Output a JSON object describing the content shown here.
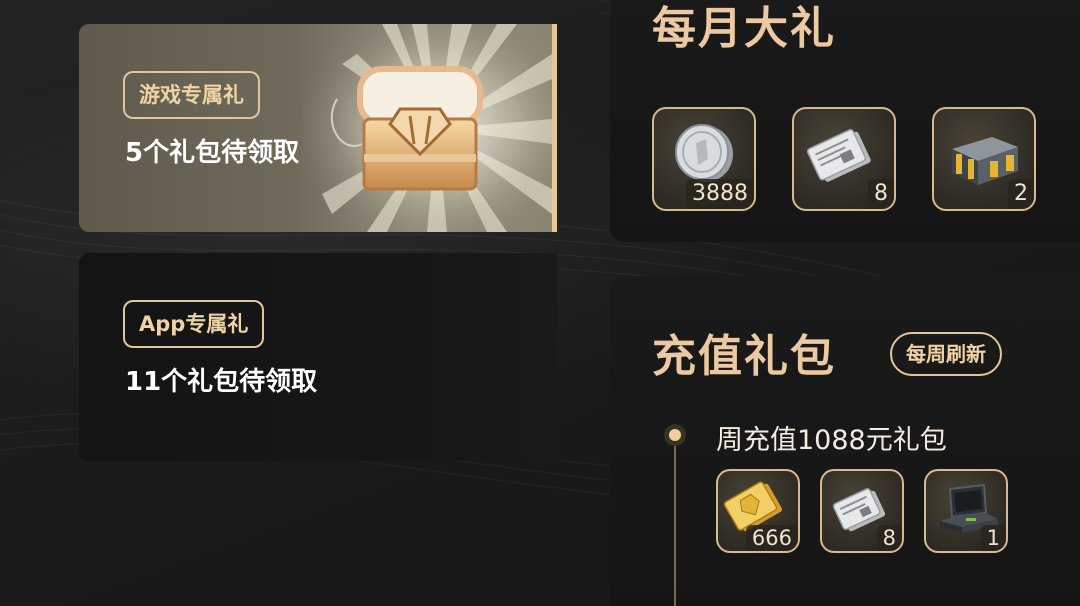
{
  "cards": [
    {
      "tag": "游戏专属礼",
      "text": "5个礼包待领取"
    },
    {
      "tag": "App专属礼",
      "text": "11个礼包待领取"
    }
  ],
  "monthly": {
    "title": "每月大礼",
    "items": [
      {
        "icon": "silver-coin-icon",
        "count": "3888"
      },
      {
        "icon": "ticket-stack-icon",
        "count": "8"
      },
      {
        "icon": "supply-crate-icon",
        "count": "2"
      }
    ]
  },
  "recharge": {
    "title": "充值礼包",
    "badge": "每周刷新",
    "package_title": "周充值1088元礼包",
    "items": [
      {
        "icon": "gold-card-icon",
        "count": "666"
      },
      {
        "icon": "ticket-stack-icon",
        "count": "8"
      },
      {
        "icon": "laptop-case-icon",
        "count": "1"
      }
    ]
  },
  "colors": {
    "accent": "#e5c898",
    "title": "#ecc9a0",
    "bg": "#1b1b1b"
  }
}
